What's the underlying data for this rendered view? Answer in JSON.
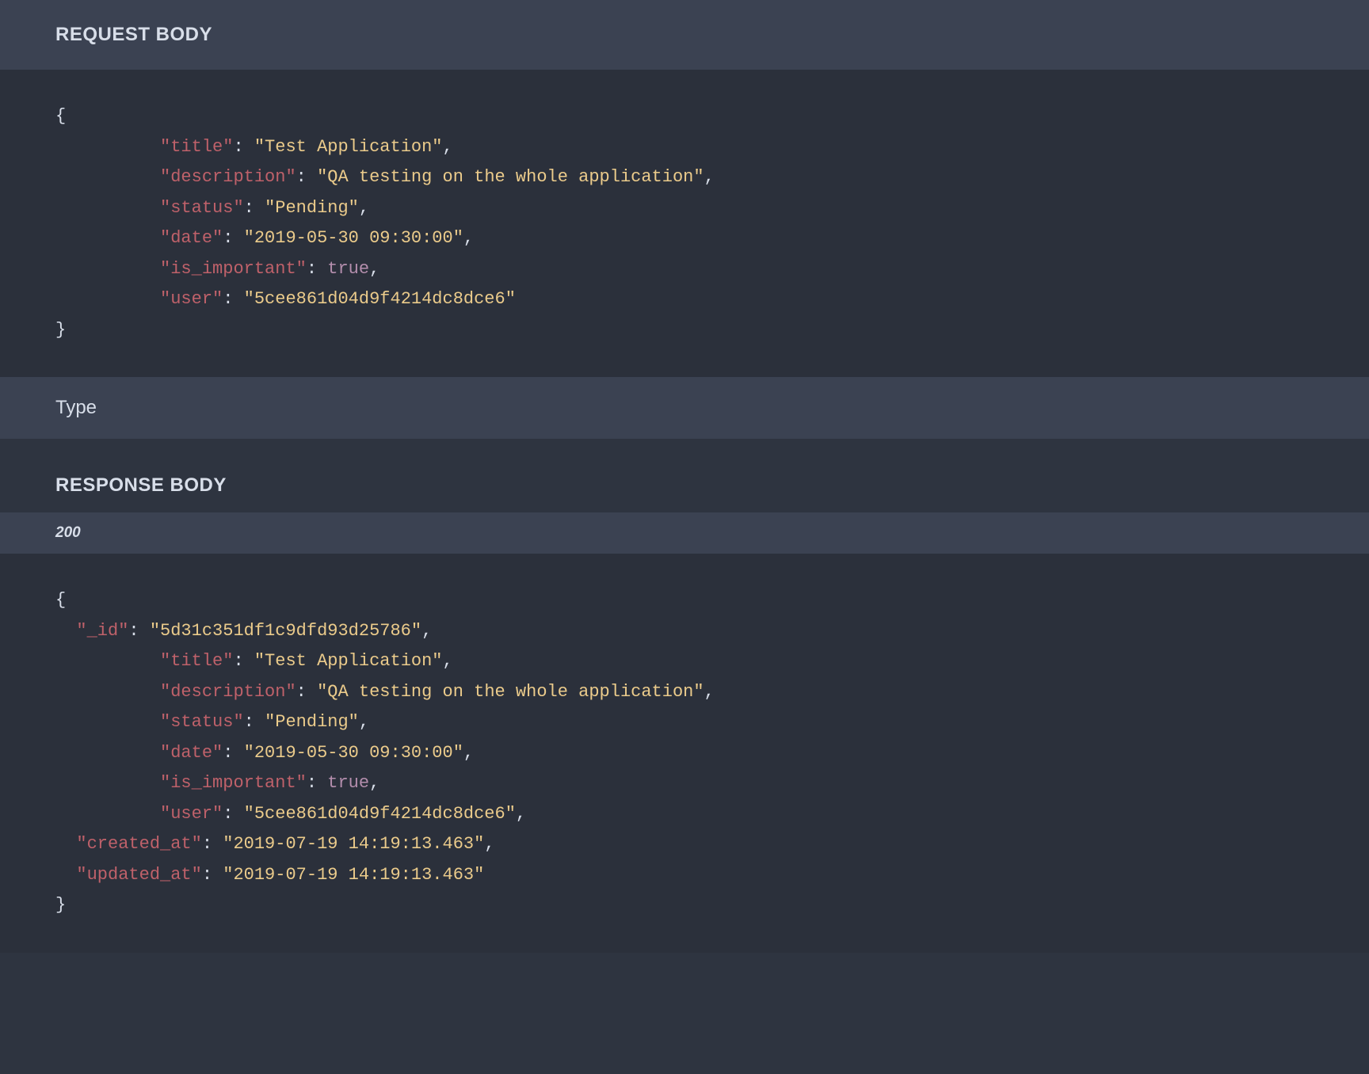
{
  "sections": {
    "request_body_label": "REQUEST BODY",
    "type_label": "Type",
    "response_body_label": "RESPONSE BODY",
    "status_code": "200"
  },
  "request": {
    "brace_open": "{",
    "brace_close": "}",
    "indent": "          ",
    "items": {
      "title_key": "\"title\"",
      "title_val": "\"Test Application\"",
      "description_key": "\"description\"",
      "description_val": "\"QA testing on the whole application\"",
      "status_key": "\"status\"",
      "status_val": "\"Pending\"",
      "date_key": "\"date\"",
      "date_val": "\"2019-05-30 09:30:00\"",
      "is_important_key": "\"is_important\"",
      "is_important_val": "true",
      "user_key": "\"user\"",
      "user_val": "\"5cee861d04d9f4214dc8dce6\""
    }
  },
  "response": {
    "brace_open": "{",
    "brace_close": "}",
    "items": {
      "id_key": "\"_id\"",
      "id_val": "\"5d31c351df1c9dfd93d25786\"",
      "title_key": "\"title\"",
      "title_val": "\"Test Application\"",
      "description_key": "\"description\"",
      "description_val": "\"QA testing on the whole application\"",
      "status_key": "\"status\"",
      "status_val": "\"Pending\"",
      "date_key": "\"date\"",
      "date_val": "\"2019-05-30 09:30:00\"",
      "is_important_key": "\"is_important\"",
      "is_important_val": "true",
      "user_key": "\"user\"",
      "user_val": "\"5cee861d04d9f4214dc8dce6\"",
      "created_at_key": "\"created_at\"",
      "created_at_val": "\"2019-07-19 14:19:13.463\"",
      "updated_at_key": "\"updated_at\"",
      "updated_at_val": "\"2019-07-19 14:19:13.463\""
    }
  },
  "punct": {
    "colon": ": ",
    "comma": ","
  }
}
